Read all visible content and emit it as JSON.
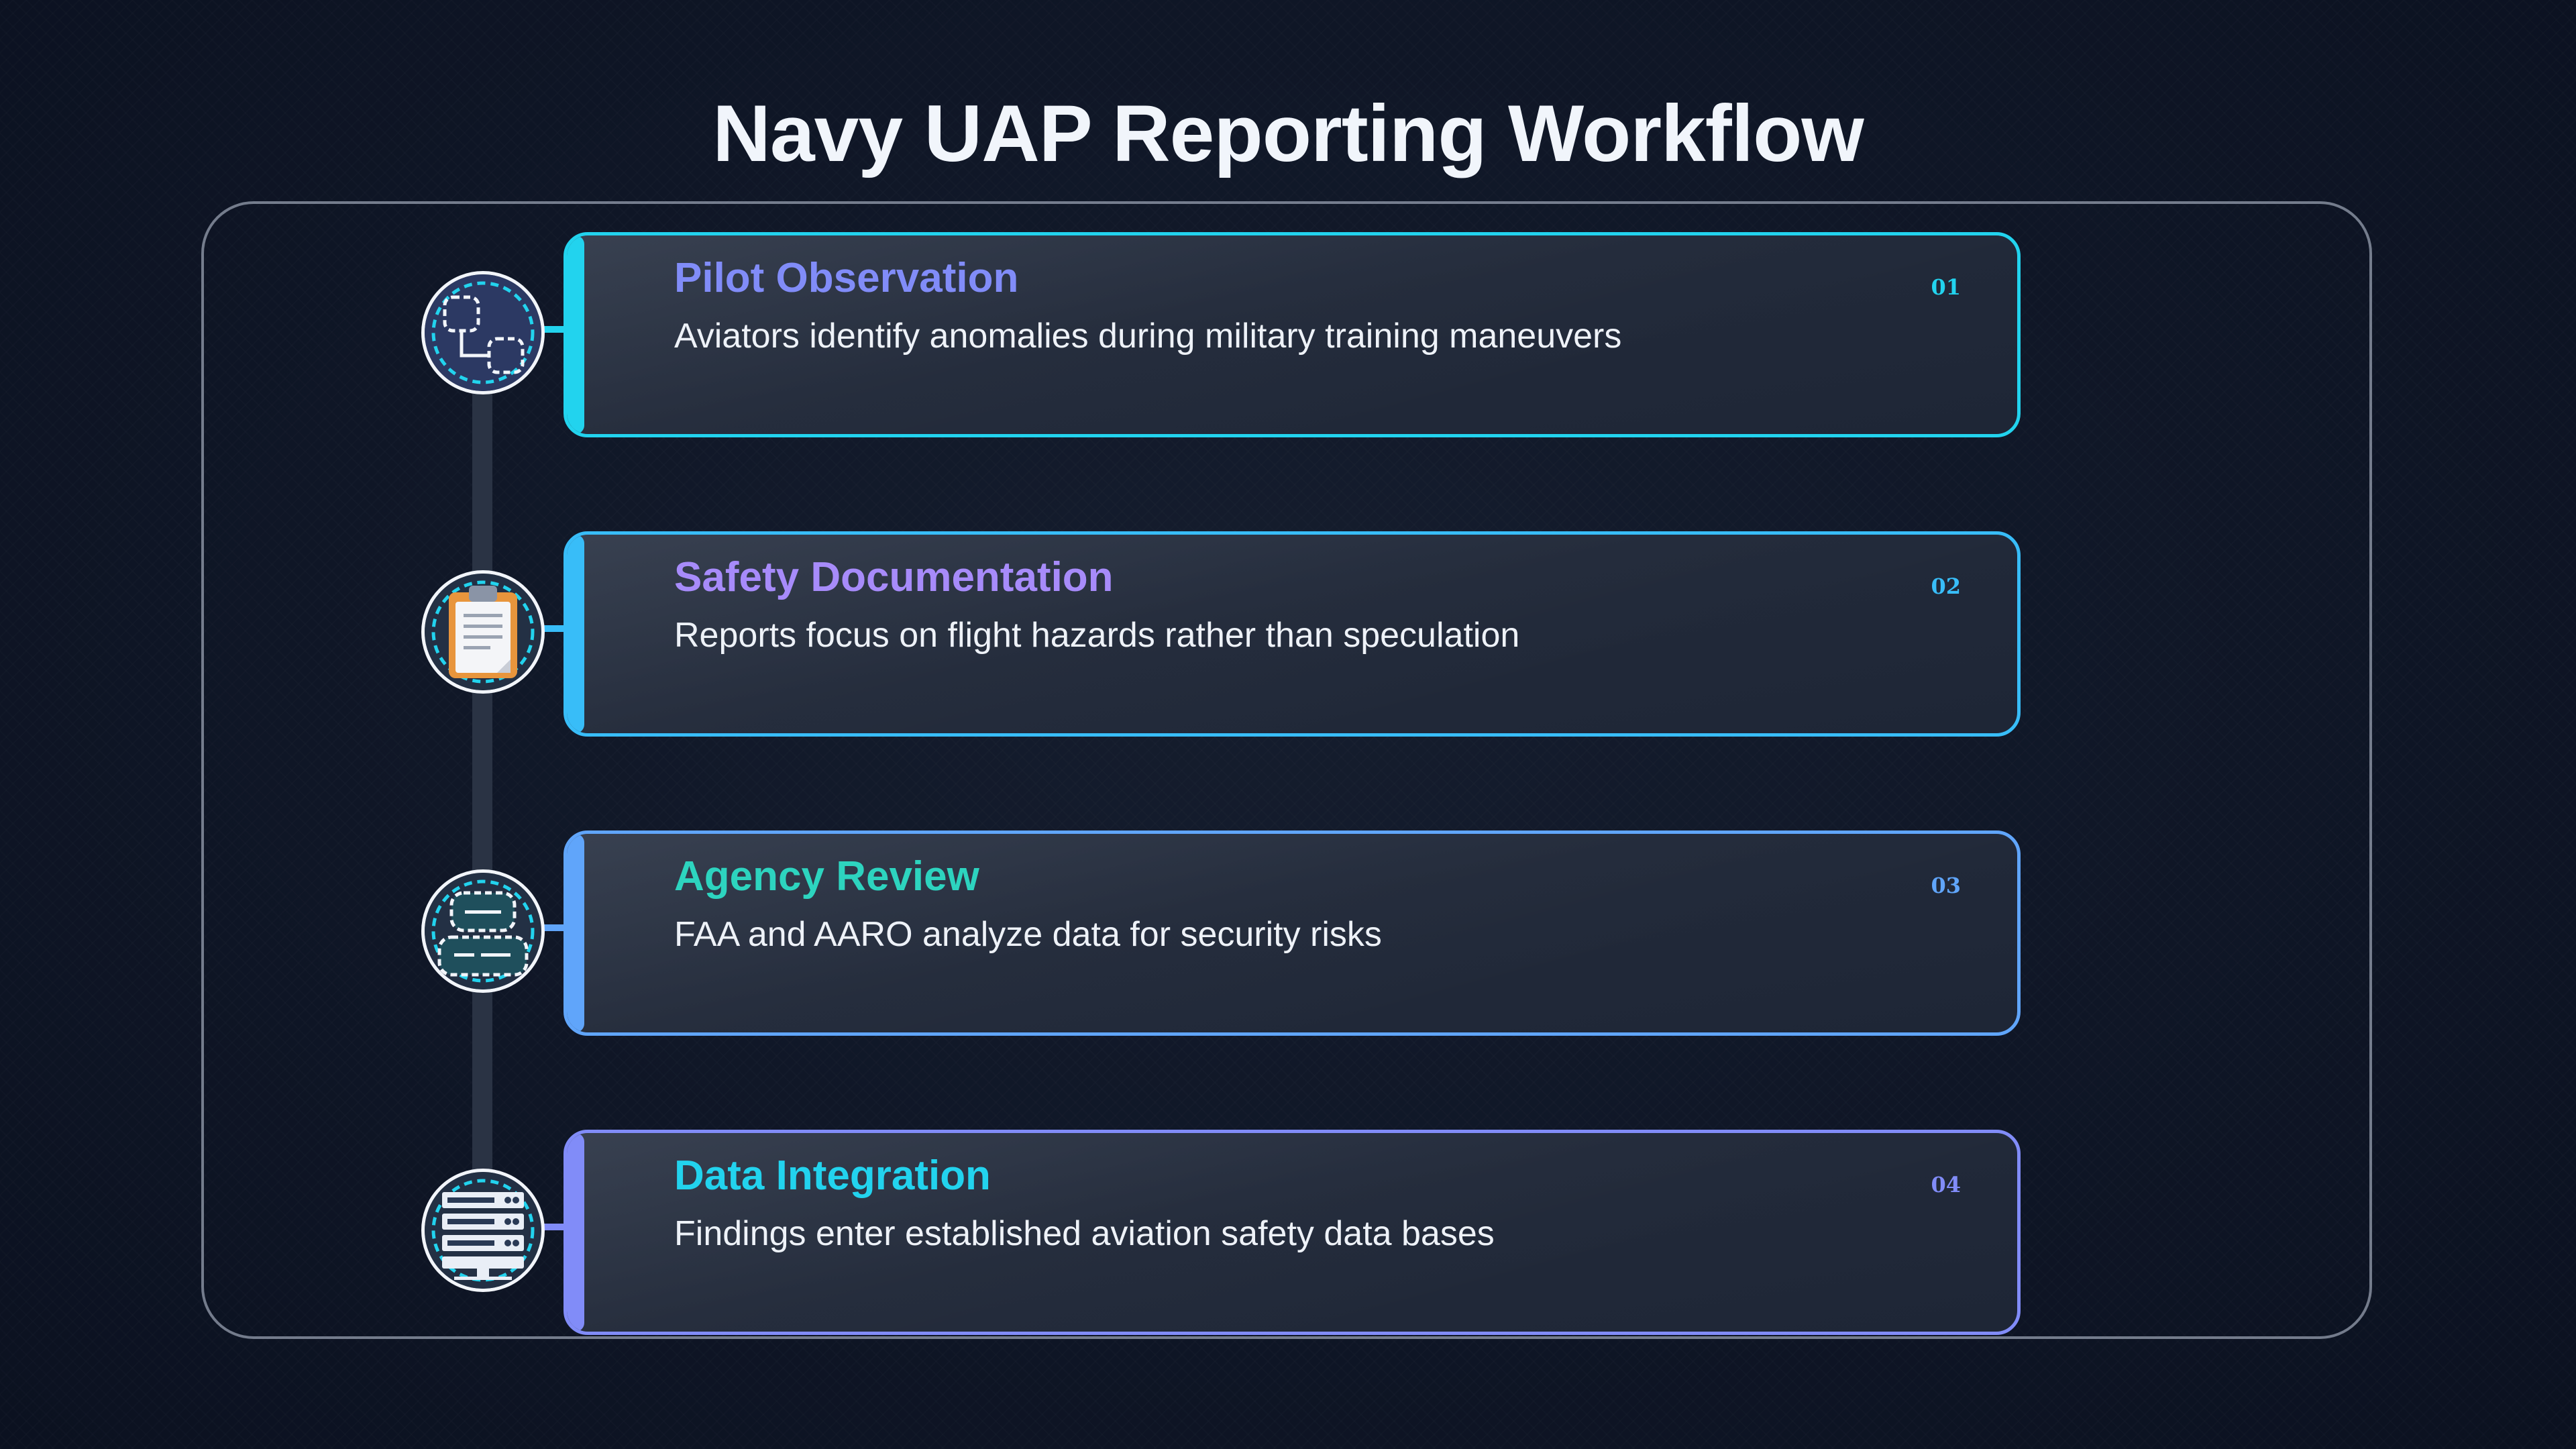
{
  "title": "Navy UAP Reporting Workflow",
  "steps": [
    {
      "title": "Pilot Observation",
      "description": "Aviators identify anomalies during military training maneuvers",
      "number": "01",
      "icon": "flowchart-icon",
      "title_color": "#818cf8",
      "border_color": "#22d3ee",
      "number_color": "#22d3ee"
    },
    {
      "title": "Safety Documentation",
      "description": "Reports focus on flight hazards rather than speculation",
      "number": "02",
      "icon": "clipboard-icon",
      "title_color": "#a78bfa",
      "border_color": "#38bdf8",
      "number_color": "#38bdf8"
    },
    {
      "title": "Agency Review",
      "description": "FAA and AARO analyze data for security risks",
      "number": "03",
      "icon": "database-icon",
      "title_color": "#2dd4bf",
      "border_color": "#60a5fa",
      "number_color": "#60a5fa"
    },
    {
      "title": "Data Integration",
      "description": "Findings enter established aviation safety data bases",
      "number": "04",
      "icon": "server-rack-icon",
      "title_color": "#22d3ee",
      "border_color": "#818cf8",
      "number_color": "#818cf8"
    }
  ]
}
